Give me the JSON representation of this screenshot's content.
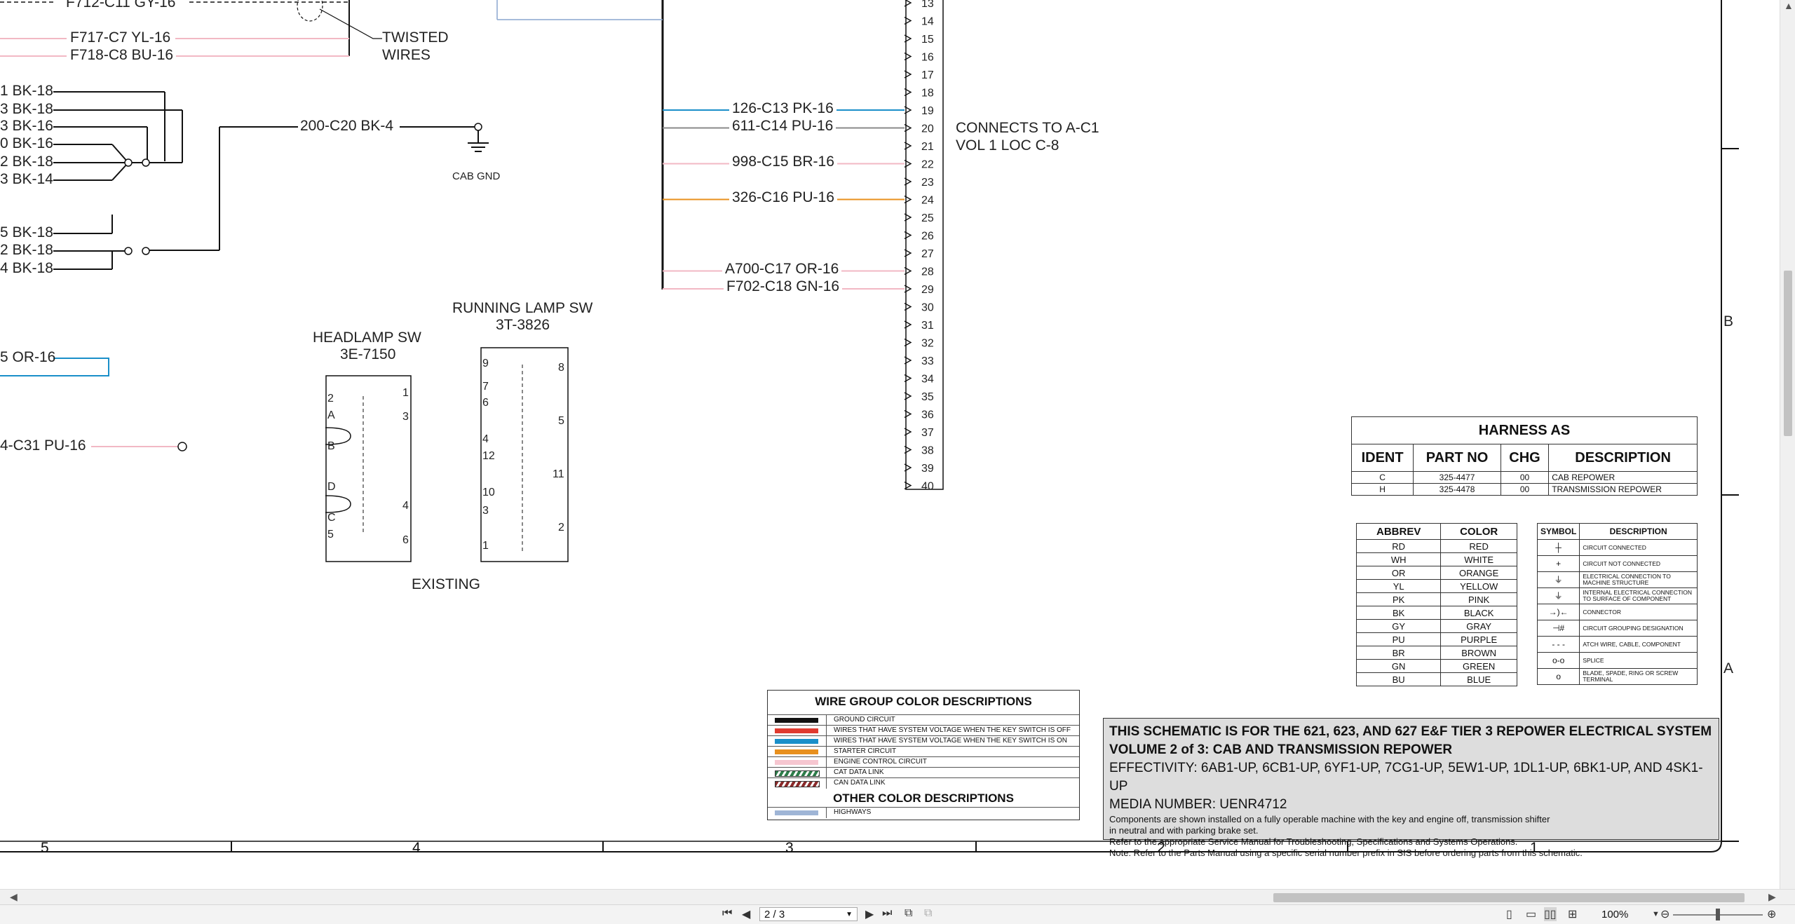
{
  "left_wires": {
    "top": [
      {
        "label": "F712-C11 GY-16"
      },
      {
        "label": "F717-C7 YL-16"
      },
      {
        "label": "F718-C8 BU-16"
      }
    ],
    "twisted_label": [
      "TWISTED",
      "WIRES"
    ],
    "ground_group_1": [
      "1 BK-18",
      "3 BK-18",
      "3 BK-16",
      "0 BK-16",
      "2 BK-18",
      "3 BK-14"
    ],
    "ground_group_2": [
      "5 BK-18",
      "2 BK-18",
      "4 BK-18"
    ],
    "or_wire": "5 OR-16",
    "pu_wire": "4-C31 PU-16",
    "cab_gnd_wire": "200-C20 BK-4",
    "cab_gnd": "CAB GND"
  },
  "switches": {
    "headlamp": {
      "title": "HEADLAMP SW",
      "part": "3E-7150",
      "pins": [
        "2",
        "A",
        "B",
        "D",
        "C",
        "5",
        "1",
        "3",
        "4",
        "6"
      ]
    },
    "running_lamp": {
      "title": "RUNNING LAMP SW",
      "part": "3T-3826",
      "pins": [
        "9",
        "7",
        "6",
        "4",
        "12",
        "10",
        "3",
        "1",
        "8",
        "5",
        "11",
        "2"
      ]
    },
    "existing_label": "EXISTING"
  },
  "connector": {
    "pins": [
      "13",
      "14",
      "15",
      "16",
      "17",
      "18",
      "19",
      "20",
      "21",
      "22",
      "23",
      "24",
      "25",
      "26",
      "27",
      "28",
      "29",
      "30",
      "31",
      "32",
      "33",
      "34",
      "35",
      "36",
      "37",
      "38",
      "39",
      "40"
    ],
    "wires": [
      {
        "pin": "19",
        "label": "126-C13 PK-16",
        "color": "#1a8fc9"
      },
      {
        "pin": "20",
        "label": "611-C14 PU-16",
        "color": "#8a8a8a"
      },
      {
        "pin": "22",
        "label": "998-C15 BR-16",
        "color": "#f2b8c4"
      },
      {
        "pin": "24",
        "label": "326-C16 PU-16",
        "color": "#e8901e"
      },
      {
        "pin": "28",
        "label": "A700-C17 OR-16",
        "color": "#f2b8c4"
      },
      {
        "pin": "29",
        "label": "F702-C18 GN-16",
        "color": "#f2b8c4"
      }
    ],
    "connects_to": [
      "CONNECTS TO A-C1",
      "VOL 1 LOC C-8"
    ]
  },
  "zone_letters": [
    "B",
    "A"
  ],
  "ruler_numbers": [
    "5",
    "4",
    "3",
    "2",
    "1"
  ],
  "harness_table": {
    "caption": "HARNESS AS",
    "headers": [
      "IDENT",
      "PART NO",
      "CHG",
      "DESCRIPTION"
    ],
    "rows": [
      [
        "C",
        "325-4477",
        "00",
        "CAB REPOWER"
      ],
      [
        "H",
        "325-4478",
        "00",
        "TRANSMISSION REPOWER"
      ]
    ]
  },
  "color_table": {
    "headers": [
      "ABBREV",
      "COLOR"
    ],
    "rows": [
      [
        "RD",
        "RED"
      ],
      [
        "WH",
        "WHITE"
      ],
      [
        "OR",
        "ORANGE"
      ],
      [
        "YL",
        "YELLOW"
      ],
      [
        "PK",
        "PINK"
      ],
      [
        "BK",
        "BLACK"
      ],
      [
        "GY",
        "GRAY"
      ],
      [
        "PU",
        "PURPLE"
      ],
      [
        "BR",
        "BROWN"
      ],
      [
        "GN",
        "GREEN"
      ],
      [
        "BU",
        "BLUE"
      ]
    ]
  },
  "symbol_table": {
    "headers": [
      "SYMBOL",
      "DESCRIPTION"
    ],
    "rows": [
      {
        "sym": "circuit-connected-symbol",
        "glyph": "┼",
        "desc": "CIRCUIT CONNECTED"
      },
      {
        "sym": "circuit-not-connected-symbol",
        "glyph": "+",
        "desc": "CIRCUIT NOT CONNECTED"
      },
      {
        "sym": "machine-ground-symbol",
        "glyph": "⏚",
        "desc": "ELECTRICAL CONNECTION TO MACHINE STRUCTURE"
      },
      {
        "sym": "component-ground-symbol",
        "glyph": "⏚",
        "desc": "INTERNAL ELECTRICAL CONNECTION TO SURFACE OF COMPONENT"
      },
      {
        "sym": "connector-symbol",
        "glyph": "→)←",
        "desc": "CONNECTOR"
      },
      {
        "sym": "grouping-symbol",
        "glyph": "⊣#",
        "desc": "CIRCUIT GROUPING DESIGNATION"
      },
      {
        "sym": "attach-wire-symbol",
        "glyph": "- - -",
        "desc": "ATCH WIRE, CABLE, COMPONENT"
      },
      {
        "sym": "splice-symbol",
        "glyph": "o-o",
        "desc": "SPLICE"
      },
      {
        "sym": "terminal-symbol",
        "glyph": "o",
        "desc": "BLADE, SPADE, RING OR SCREW TERMINAL"
      }
    ]
  },
  "wire_group": {
    "title": "WIRE GROUP COLOR DESCRIPTIONS",
    "rows": [
      {
        "swatch": "#111111",
        "text": "GROUND CIRCUIT"
      },
      {
        "swatch": "#e03a2f",
        "text": "WIRES THAT HAVE SYSTEM VOLTAGE WHEN THE KEY SWITCH IS OFF"
      },
      {
        "swatch": "#1a8fc9",
        "text": "WIRES THAT HAVE SYSTEM VOLTAGE WHEN THE KEY SWITCH IS ON"
      },
      {
        "swatch": "#e8901e",
        "text": "STARTER CIRCUIT"
      },
      {
        "swatch": "#f6c6d0",
        "text": "ENGINE CONTROL CIRCUIT"
      },
      {
        "swatch": "#2e7d4a",
        "text": "CAT DATA LINK"
      },
      {
        "swatch": "#8a2a2a",
        "text": "CAN DATA LINK"
      }
    ],
    "other_title": "OTHER COLOR DESCRIPTIONS",
    "other_rows": [
      {
        "swatch": "#9fb5d6",
        "text": "HIGHWAYS"
      }
    ]
  },
  "title_block": {
    "line1": "THIS SCHEMATIC IS FOR THE 621, 623, AND 627 E&F TIER 3 REPOWER ELECTRICAL SYSTEM",
    "line2": "VOLUME 2 of 3: CAB AND TRANSMISSION REPOWER",
    "line3": "EFFECTIVITY: 6AB1-UP, 6CB1-UP, 6YF1-UP, 7CG1-UP, 5EW1-UP, 1DL1-UP, 6BK1-UP, AND 4SK1-UP",
    "line4": "MEDIA NUMBER: UENR4712",
    "note1": "Components are shown installed on a fully operable machine with the key and engine off, transmission shifter",
    "note2": "in neutral and with parking brake set.",
    "note3": "Refer to the appropriate Service Manual for Troubleshooting, Specifications and Systems Operations.",
    "note4": "Note: Refer to the Parts Manual using a specific serial number prefix in SIS before ordering parts from this schematic."
  },
  "viewer": {
    "page_field": "2 / 3",
    "zoom": "100%"
  }
}
